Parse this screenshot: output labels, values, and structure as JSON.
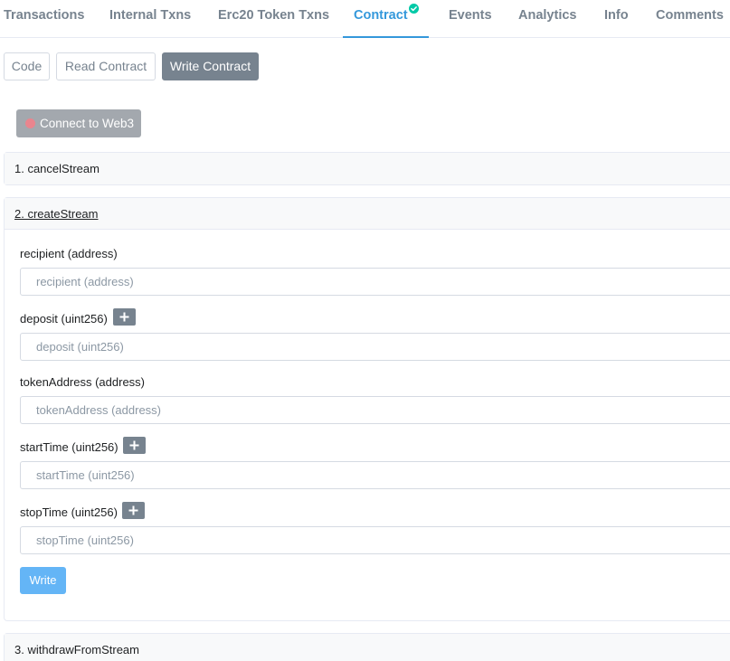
{
  "tabs": [
    {
      "label": "Transactions"
    },
    {
      "label": "Internal Txns"
    },
    {
      "label": "Erc20 Token Txns"
    },
    {
      "label": "Contract",
      "active": true,
      "verified": true
    },
    {
      "label": "Events"
    },
    {
      "label": "Analytics"
    },
    {
      "label": "Info"
    },
    {
      "label": "Comments"
    }
  ],
  "subtabs": [
    {
      "label": "Code"
    },
    {
      "label": "Read Contract"
    },
    {
      "label": "Write Contract",
      "active": true
    }
  ],
  "connect": {
    "label": "Connect to Web3",
    "status_color": "#e9858e"
  },
  "functions": [
    {
      "label": "1. cancelStream"
    },
    {
      "label": "2. createStream",
      "expanded": true,
      "inputs": [
        {
          "label": "recipient (address)",
          "placeholder": "recipient (address)",
          "has_plus": false
        },
        {
          "label": "deposit (uint256)",
          "placeholder": "deposit (uint256)",
          "has_plus": true
        },
        {
          "label": "tokenAddress (address)",
          "placeholder": "tokenAddress (address)",
          "has_plus": false
        },
        {
          "label": "startTime (uint256)",
          "placeholder": "startTime (uint256)",
          "has_plus": true
        },
        {
          "label": "stopTime (uint256)",
          "placeholder": "stopTime (uint256)",
          "has_plus": true
        }
      ],
      "write_label": "Write"
    },
    {
      "label": "3. withdrawFromStream"
    }
  ],
  "colors": {
    "accent": "#3498db",
    "verified": "#00c9a7",
    "write_button": "#64b5f6",
    "muted": "#77838f"
  },
  "icons": {
    "verified": "check-circle-icon",
    "plus": "plus-icon",
    "status": "status-dot-icon"
  }
}
